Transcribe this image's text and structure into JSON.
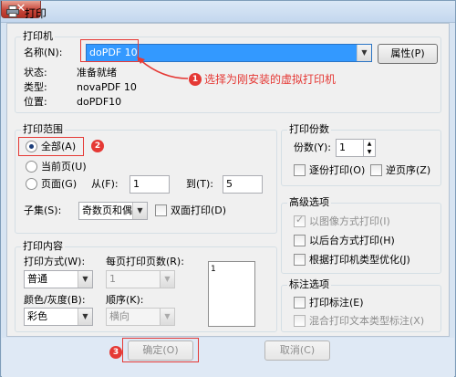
{
  "window": {
    "title": "打印",
    "close_glyph": "✕"
  },
  "printer": {
    "group_label": "打印机",
    "name_label": "名称(N):",
    "name_value": "doPDF 10",
    "properties_button": "属性(P)",
    "status_label": "状态:",
    "status_value": "准备就绪",
    "type_label": "类型:",
    "type_value": "novaPDF 10",
    "location_label": "位置:",
    "location_value": "doPDF10"
  },
  "annotations": {
    "step1_number": "1",
    "step1_text": "选择为刚安装的虚拟打印机",
    "step2_number": "2",
    "step3_number": "3",
    "color": "#e53935"
  },
  "print_range": {
    "group_label": "打印范围",
    "all_label": "全部(A)",
    "current_page_label": "当前页(U)",
    "pages_label": "页面(G)",
    "from_label": "从(F):",
    "from_value": "1",
    "to_label": "到(T):",
    "to_value": "5",
    "subset_label": "子集(S):",
    "subset_value": "奇数页和偶",
    "duplex_label": "双面打印(D)",
    "selected": "all"
  },
  "copies": {
    "group_label": "打印份数",
    "copies_label": "份数(Y):",
    "copies_value": "1",
    "collate_label": "逐份打印(O)",
    "reverse_label": "逆页序(Z)"
  },
  "advanced": {
    "group_label": "高级选项",
    "image_print_label": "以图像方式打印(I)",
    "background_label": "以后台方式打印(H)",
    "optimize_label": "根据打印机类型优化(J)"
  },
  "content": {
    "group_label": "打印内容",
    "method_label": "打印方式(W):",
    "method_value": "普通",
    "pages_per_sheet_label": "每页打印页数(R):",
    "pages_per_sheet_value": "1",
    "color_label": "颜色/灰度(B):",
    "color_value": "彩色",
    "order_label": "顺序(K):",
    "order_value": "横向",
    "preview_page": "1"
  },
  "markup": {
    "group_label": "标注选项",
    "print_markup_label": "打印标注(E)",
    "mixed_label": "混合打印文本类型标注(X)"
  },
  "footer": {
    "ok_button": "确定(O)",
    "cancel_button": "取消(C)"
  },
  "colors": {
    "selection": "#3399ff",
    "dialog_frame": "#d7e4f2",
    "panel": "#f0f0f0"
  }
}
